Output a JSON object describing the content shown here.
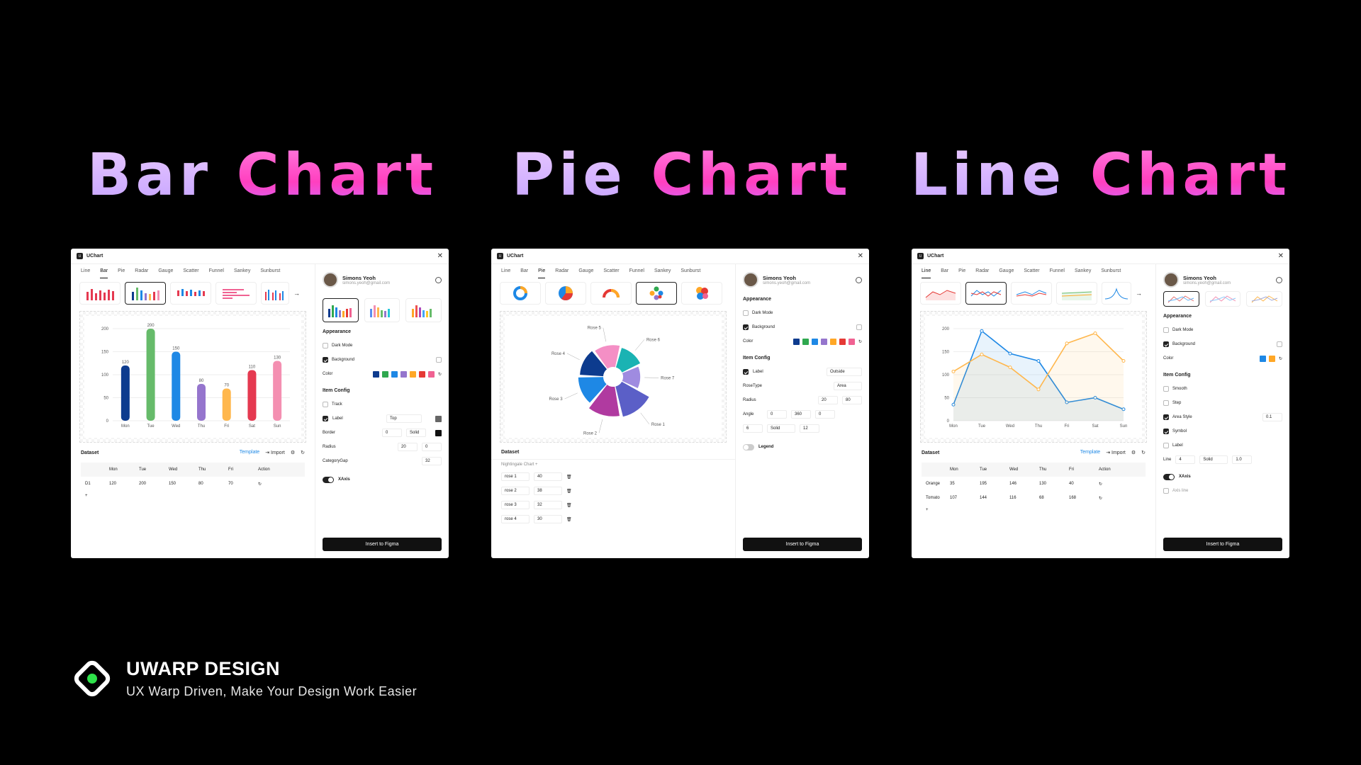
{
  "headings": {
    "bar": {
      "w1": "Bar",
      "w2": "Chart"
    },
    "pie": {
      "w1": "Pie",
      "w2": "Chart"
    },
    "line": {
      "w1": "Line",
      "w2": "Chart"
    }
  },
  "common": {
    "app_title": "UChart",
    "user_name": "Simons Yeoh",
    "user_email": "simons.yeoh@gmail.com",
    "appearance": "Appearance",
    "dark_mode": "Dark Mode",
    "background": "Background",
    "color": "Color",
    "item_config": "Item Config",
    "dataset": "Dataset",
    "template": "Template",
    "import": "Import",
    "insert": "Insert to Figma",
    "xaxis": "XAxis",
    "palette": [
      "#0d3b8e",
      "#2fa84f",
      "#1e88e5",
      "#9575cd",
      "#ffa726",
      "#e53935",
      "#f06292"
    ]
  },
  "bar_panel": {
    "tabs": [
      "Line",
      "Bar",
      "Pie",
      "Radar",
      "Gauge",
      "Scatter",
      "Funnel",
      "Sankey",
      "Sunburst"
    ],
    "active_tab": "Bar",
    "track": "Track",
    "label": "Label",
    "label_pos": "Top",
    "border": "Border",
    "border_w": "0",
    "border_style": "Solid",
    "radius": "Radius",
    "radius_a": "20",
    "radius_b": "0",
    "category_gap": "CategoryGap",
    "category_gap_val": "32",
    "table": {
      "headers": [
        "",
        "Mon",
        "Tue",
        "Wed",
        "Thu",
        "Fri",
        "Action"
      ],
      "rows": [
        [
          "D1",
          "120",
          "200",
          "150",
          "80",
          "70"
        ]
      ]
    }
  },
  "pie_panel": {
    "tabs": [
      "Line",
      "Bar",
      "Pie",
      "Radar",
      "Gauge",
      "Scatter",
      "Funnel",
      "Sankey",
      "Sunburst"
    ],
    "active_tab": "Pie",
    "label": "Label",
    "label_pos": "Outside",
    "rosetype": "RoseType",
    "rosetype_val": "Area",
    "radius": "Radius",
    "radius_a": "20",
    "radius_b": "80",
    "angle": "Angle",
    "angle_a": "0",
    "angle_b": "360",
    "angle_c": "0",
    "border_w": "6",
    "border_style": "Solid",
    "border_r": "12",
    "legend": "Legend",
    "series_title": "Nightingale Chart",
    "rows": [
      {
        "name": "rose 1",
        "value": "40"
      },
      {
        "name": "rose 2",
        "value": "38"
      },
      {
        "name": "rose 3",
        "value": "32"
      },
      {
        "name": "rose 4",
        "value": "30"
      }
    ]
  },
  "line_panel": {
    "tabs": [
      "Line",
      "Bar",
      "Pie",
      "Radar",
      "Gauge",
      "Scatter",
      "Funnel",
      "Sankey",
      "Sunburst"
    ],
    "active_tab": "Line",
    "smooth": "Smooth",
    "step": "Step",
    "area_style": "Area Style",
    "area_val": "0.1",
    "symbol": "Symbol",
    "label": "Label",
    "line": "Line",
    "line_w": "4",
    "line_style": "Solid",
    "line_op": "1.0",
    "axis_line": "Axis line",
    "table": {
      "headers": [
        "",
        "Mon",
        "Tue",
        "Wed",
        "Thu",
        "Fri",
        "Action"
      ],
      "rows": [
        [
          "Orange",
          "35",
          "195",
          "146",
          "130",
          "40"
        ],
        [
          "Tomato",
          "107",
          "144",
          "116",
          "68",
          "168"
        ]
      ]
    }
  },
  "chart_data": [
    {
      "type": "bar",
      "categories": [
        "Mon",
        "Tue",
        "Wed",
        "Thu",
        "Fri",
        "Sat",
        "Sun"
      ],
      "values": [
        120,
        200,
        150,
        80,
        70,
        110,
        130
      ],
      "ylim": [
        0,
        200
      ],
      "yticks": [
        0,
        50,
        100,
        150,
        200
      ],
      "colors": [
        "#0d3b8e",
        "#66bb6a",
        "#1e88e5",
        "#9575cd",
        "#ffb74d",
        "#e53950",
        "#f48fb1"
      ]
    },
    {
      "type": "pie",
      "rose": true,
      "series": [
        {
          "name": "Rose 1",
          "value": 40
        },
        {
          "name": "Rose 2",
          "value": 38
        },
        {
          "name": "Rose 3",
          "value": 32
        },
        {
          "name": "Rose 4",
          "value": 30
        },
        {
          "name": "Rose 5",
          "value": 28
        },
        {
          "name": "Rose 6",
          "value": 26
        },
        {
          "name": "Rose 7",
          "value": 22
        }
      ],
      "colors": [
        "#5b5fc7",
        "#b03aa0",
        "#1e88e5",
        "#0d3b8e",
        "#f48fc5",
        "#1ab3b3",
        "#9f8be0"
      ]
    },
    {
      "type": "line",
      "categories": [
        "Mon",
        "Tue",
        "Wed",
        "Thu",
        "Fri",
        "Sat",
        "Sun"
      ],
      "ylim": [
        0,
        200
      ],
      "yticks": [
        0,
        50,
        100,
        150,
        200
      ],
      "series": [
        {
          "name": "",
          "color": "#1e88e5",
          "values": [
            35,
            195,
            146,
            130,
            40,
            50,
            25
          ]
        },
        {
          "name": "",
          "color": "#ffb74d",
          "values": [
            107,
            144,
            116,
            68,
            168,
            190,
            130
          ]
        }
      ]
    }
  ],
  "brand": {
    "name": "UWARP DESIGN",
    "tagline": "UX Warp Driven, Make Your Design Work Easier"
  }
}
